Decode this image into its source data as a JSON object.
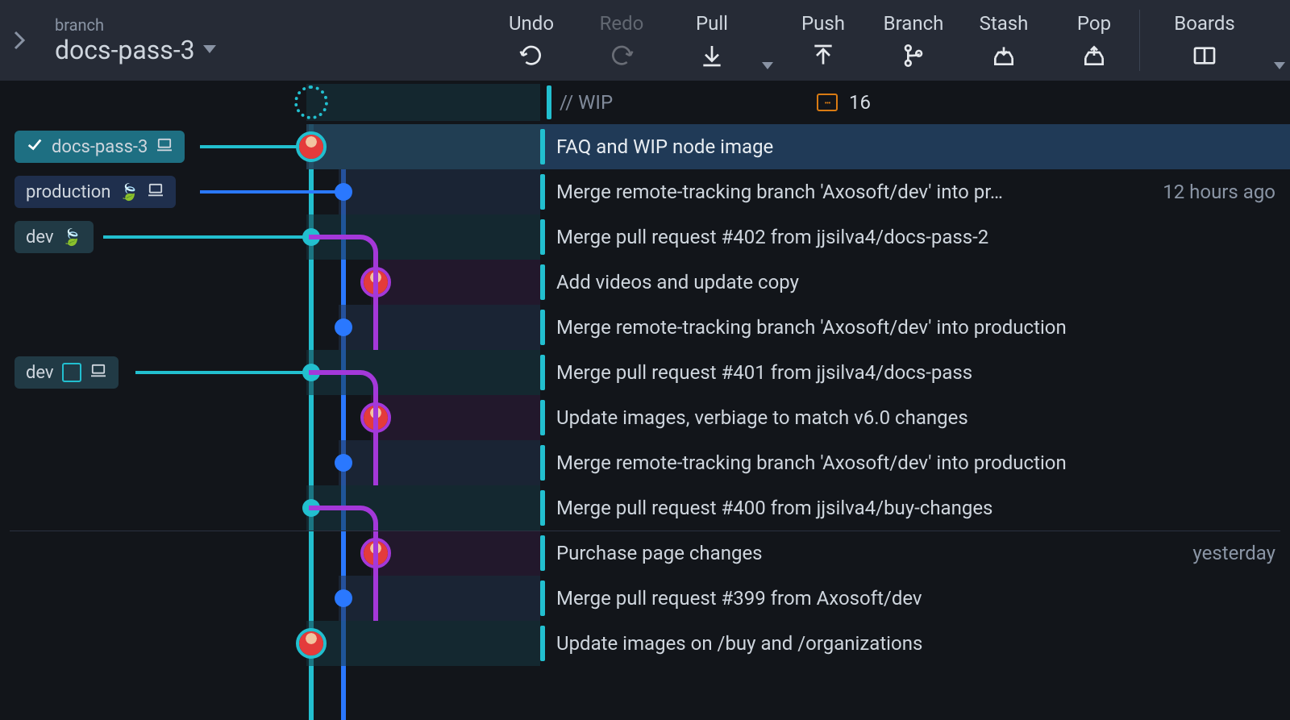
{
  "toolbar": {
    "branch_label": "branch",
    "branch_name": "docs-pass-3",
    "undo": "Undo",
    "redo": "Redo",
    "pull": "Pull",
    "push": "Push",
    "branch_btn": "Branch",
    "stash": "Stash",
    "pop": "Pop",
    "boards": "Boards"
  },
  "wip": {
    "placeholder": "// WIP",
    "file_count": "16"
  },
  "tags": [
    {
      "id": "docs-pass-3",
      "label": "docs-pass-3",
      "row": 0,
      "style": "sel",
      "check": true,
      "leaf": false,
      "laptop": true,
      "avatar": false,
      "track": 0
    },
    {
      "id": "production",
      "label": "production",
      "row": 1,
      "style": "blue",
      "check": false,
      "leaf": true,
      "laptop": true,
      "avatar": false,
      "track": 1
    },
    {
      "id": "dev-leaf",
      "label": "dev",
      "row": 2,
      "style": "",
      "check": false,
      "leaf": true,
      "laptop": false,
      "avatar": false,
      "track": 0
    },
    {
      "id": "dev-avatar",
      "label": "dev",
      "row": 5,
      "style": "",
      "check": false,
      "leaf": false,
      "laptop": true,
      "avatar": true,
      "track": 0
    }
  ],
  "commits": [
    {
      "message": "FAQ and WIP node image",
      "time": "",
      "track": 0,
      "avatar": true,
      "selected": true
    },
    {
      "message": "Merge remote-tracking branch 'Axosoft/dev' into pr…",
      "time": "12 hours ago",
      "track": 1,
      "avatar": false,
      "selected": false
    },
    {
      "message": "Merge pull request #402 from jjsilva4/docs-pass-2",
      "time": "",
      "track": 0,
      "avatar": false,
      "selected": false
    },
    {
      "message": "Add videos and update copy",
      "time": "",
      "track": 2,
      "avatar": true,
      "selected": false
    },
    {
      "message": "Merge remote-tracking branch 'Axosoft/dev' into production",
      "time": "",
      "track": 1,
      "avatar": false,
      "selected": false
    },
    {
      "message": "Merge pull request #401 from jjsilva4/docs-pass",
      "time": "",
      "track": 0,
      "avatar": false,
      "selected": false
    },
    {
      "message": "Update images, verbiage to match v6.0 changes",
      "time": "",
      "track": 2,
      "avatar": true,
      "selected": false
    },
    {
      "message": "Merge remote-tracking branch 'Axosoft/dev' into production",
      "time": "",
      "track": 1,
      "avatar": false,
      "selected": false
    },
    {
      "message": "Merge pull request #400 from jjsilva4/buy-changes",
      "time": "",
      "track": 0,
      "avatar": false,
      "selected": false
    },
    {
      "message": "Purchase page changes",
      "time": "yesterday",
      "track": 2,
      "avatar": true,
      "selected": false
    },
    {
      "message": "Merge pull request #399 from Axosoft/dev",
      "time": "",
      "track": 1,
      "avatar": false,
      "selected": false
    },
    {
      "message": "Update images on /buy and /organizations",
      "time": "",
      "track": 0,
      "avatar": true,
      "selected": false
    }
  ],
  "colors": {
    "teal": "#22bfcf",
    "blue": "#2a78ff",
    "purple": "#a438d9",
    "orange": "#d97b13"
  }
}
